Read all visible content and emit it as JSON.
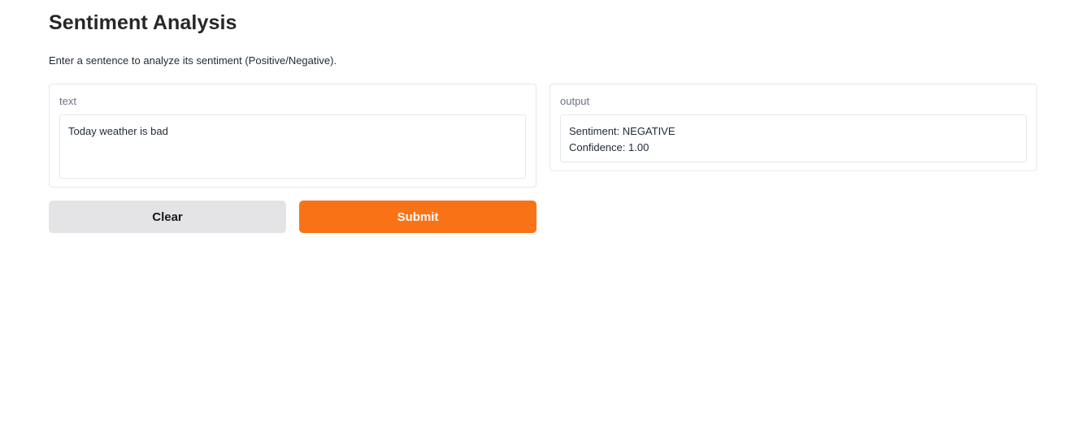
{
  "page": {
    "title": "Sentiment Analysis",
    "description": "Enter a sentence to analyze its sentiment (Positive/Negative)."
  },
  "input_panel": {
    "label": "text",
    "value": "Today weather is bad"
  },
  "output_panel": {
    "label": "output",
    "lines": [
      "Sentiment: NEGATIVE",
      "Confidence: 1.00"
    ]
  },
  "buttons": {
    "clear_label": "Clear",
    "submit_label": "Submit"
  },
  "colors": {
    "accent": "#f97316",
    "secondary_button": "#e4e4e7",
    "border": "#e5e7eb",
    "label_text": "#6b7280"
  }
}
